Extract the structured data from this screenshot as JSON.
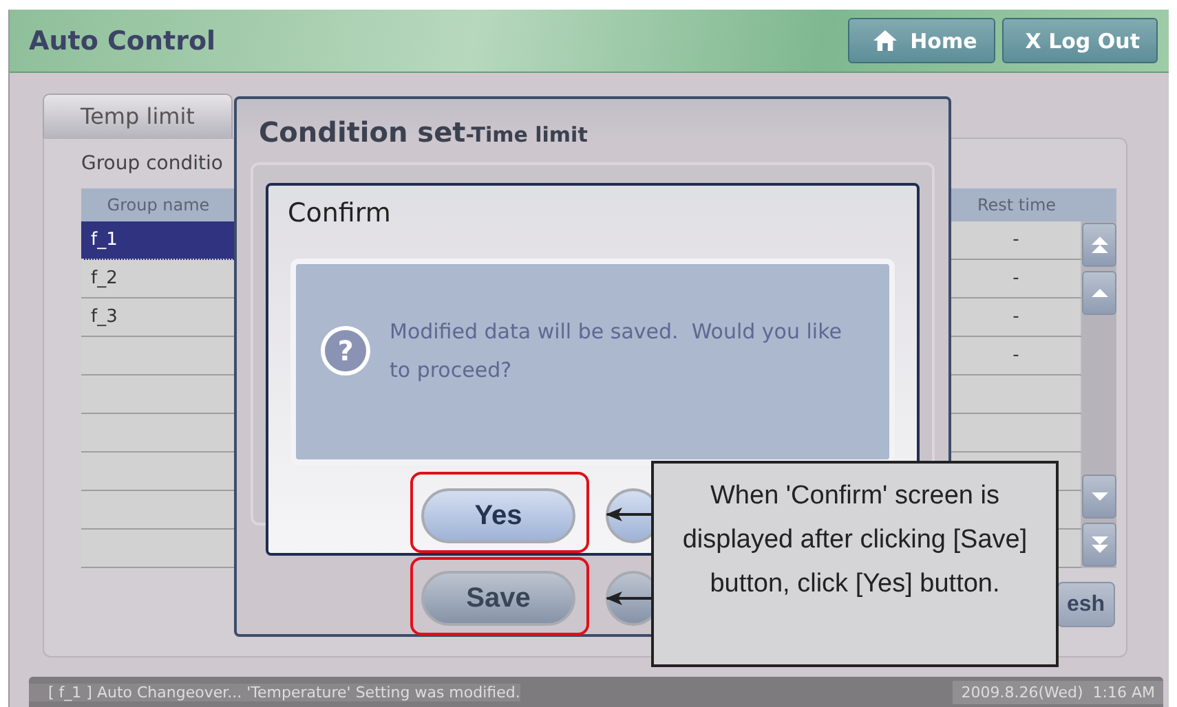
{
  "header": {
    "title": "Auto Control",
    "buttons": [
      {
        "kind": "home",
        "label": "Home"
      },
      {
        "kind": "logout",
        "label": "X Log Out"
      }
    ]
  },
  "tabs": [
    {
      "label": "Temp limit",
      "selected": true
    }
  ],
  "panel": {
    "label": "Group conditio",
    "columns": [
      "Group name",
      "Rest time"
    ],
    "rows": [
      {
        "group": "f_1",
        "rest": "-",
        "selected": true
      },
      {
        "group": "f_2",
        "rest": "-",
        "selected": false
      },
      {
        "group": "f_3",
        "rest": "-",
        "selected": false
      },
      {
        "rest": "-",
        "selected": false
      }
    ],
    "refresh_button": "esh"
  },
  "condition_dialog": {
    "title": "Condition set",
    "subtitle": "-Time limit",
    "save_button": "Save"
  },
  "confirm_dialog": {
    "title": "Confirm",
    "icon": "?",
    "message": "Modified data will be saved.  Would you like to proceed?",
    "buttons": [
      "Yes"
    ]
  },
  "callout": {
    "text": "When 'Confirm' screen is displayed after clicking [Save] button, click [Yes] button."
  },
  "status_bar": {
    "message": "[ f_1 ] Auto Changeover... 'Temperature' Setting was modified.",
    "datetime": "2009.8.26(Wed)  1:16 AM"
  }
}
